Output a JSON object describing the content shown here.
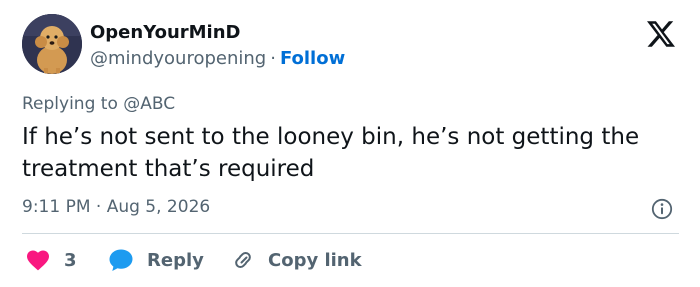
{
  "author": {
    "name": "OpenYourMinD",
    "handle": "@mindyouropening",
    "separator": "·",
    "follow_label": "Follow",
    "avatar_icon": "dog-avatar"
  },
  "brand": {
    "logo_icon": "x-logo-icon",
    "color": "#0f1419"
  },
  "reply_context": {
    "prefix": "Replying to",
    "mention": "@ABC"
  },
  "tweet": {
    "text": "If he’s not sent to the looney bin, he’s not getting the treatment that’s required",
    "timestamp": "9:11 PM · Aug 5, 2026",
    "info_icon": "info-icon"
  },
  "actions": {
    "like_count": "3",
    "like_color": "#f91880",
    "reply_label": "Reply",
    "reply_color": "#1d9bf0",
    "copy_label": "Copy link"
  },
  "colors": {
    "follow": "#006fd6",
    "secondary_text": "#536471",
    "divider": "#cfd9de"
  }
}
